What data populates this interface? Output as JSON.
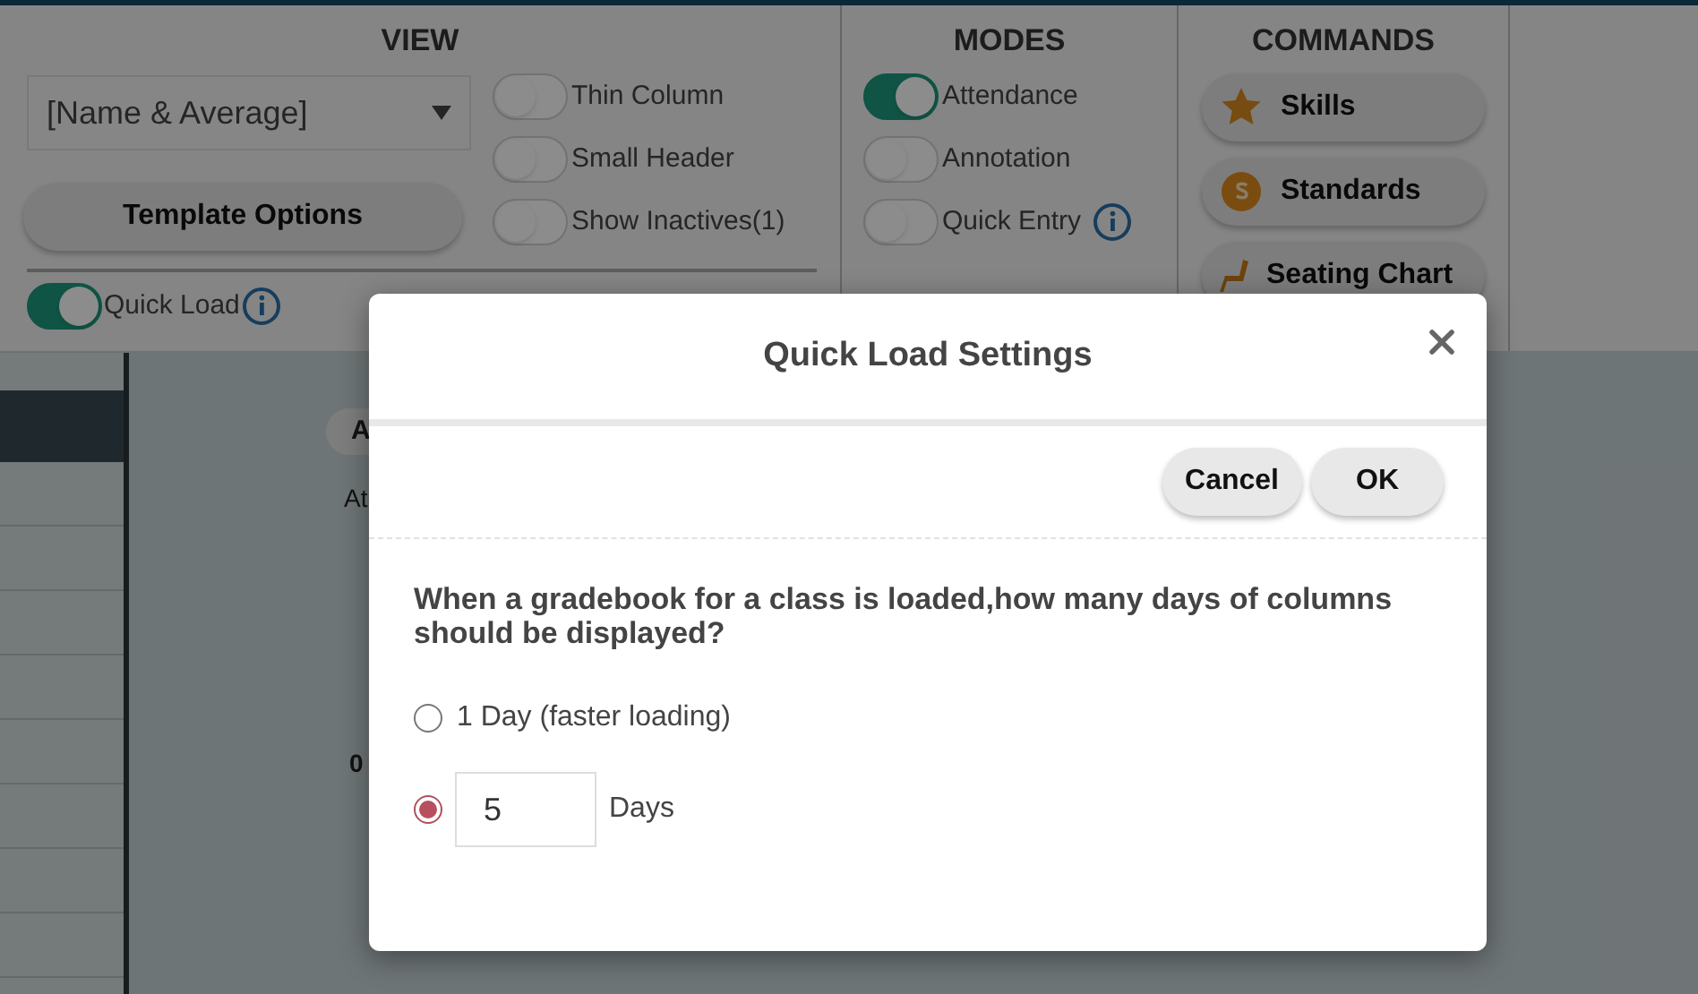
{
  "toolbar": {
    "view": {
      "title": "VIEW",
      "dropdown": {
        "value": "[Name & Average]"
      },
      "template_button": "Template Options",
      "toggles": [
        {
          "label": "Thin Column",
          "on": false
        },
        {
          "label": "Small Header",
          "on": false
        },
        {
          "label": "Show Inactives(1)",
          "on": false
        }
      ],
      "quick_load": {
        "label": "Quick Load",
        "on": true
      }
    },
    "modes": {
      "title": "MODES",
      "toggles": [
        {
          "label": "Attendance",
          "on": true,
          "info": false
        },
        {
          "label": "Annotation",
          "on": false,
          "info": false
        },
        {
          "label": "Quick Entry",
          "on": false,
          "info": true
        }
      ]
    },
    "commands": {
      "title": "COMMANDS",
      "buttons": [
        {
          "label": "Skills",
          "kind": "star"
        },
        {
          "label": "Standards",
          "kind": "coin"
        },
        {
          "label": "Seating Chart",
          "kind": "seat"
        }
      ]
    }
  },
  "background": {
    "column_button": "A",
    "column_label": "At",
    "cell": "0"
  },
  "dialog": {
    "title": "Quick Load Settings",
    "buttons": [
      "Cancel",
      "OK"
    ],
    "question": "When a gradebook for a class is loaded,how many days of columns should be displayed?",
    "options": [
      {
        "kind": "radio",
        "label": "1 Day (faster loading)",
        "selected": false
      },
      {
        "kind": "days",
        "count": "5",
        "unit": "Days",
        "selected": true
      }
    ]
  }
}
